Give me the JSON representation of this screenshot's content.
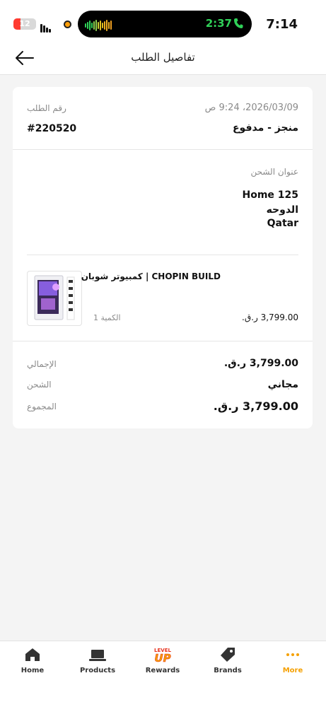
{
  "status_bar": {
    "battery": "12",
    "island_time": "2:37",
    "clock": "7:14"
  },
  "header": {
    "title": "تفاصيل الطلب"
  },
  "order": {
    "number_label": "رقم الطلب",
    "number": "#220520",
    "datetime": "2026/03/09، 9:24 ص",
    "status": "منجز - مدفوع"
  },
  "shipping": {
    "label": "عنوان الشحن",
    "line1": "Home 125",
    "city": "الدوحه",
    "country": "Qatar"
  },
  "item": {
    "name": "كمبيوتر شوبان | CHOPIN BUILD",
    "quantity": "الكمية 1",
    "price": "3,799.00 ر.ق."
  },
  "totals": {
    "subtotal_label": "الإجمالي",
    "subtotal": "3,799.00 ر.ق.",
    "shipping_label": "الشحن",
    "shipping": "مجاني",
    "total_label": "المجموع",
    "total": "3,799.00 ر.ق."
  },
  "bottom_nav": {
    "home": "Home",
    "products": "Products",
    "rewards": "Rewards",
    "brands": "Brands",
    "more": "More",
    "rewards_logo_line1": "LEVEL",
    "rewards_logo_line2": "UP"
  },
  "colors": {
    "accent": "#f5a000",
    "island_green": "#30d158"
  },
  "icons": [
    "back-arrow-icon",
    "home-icon",
    "laptop-icon",
    "level-up-logo",
    "tag-icon",
    "more-dots-icon"
  ]
}
